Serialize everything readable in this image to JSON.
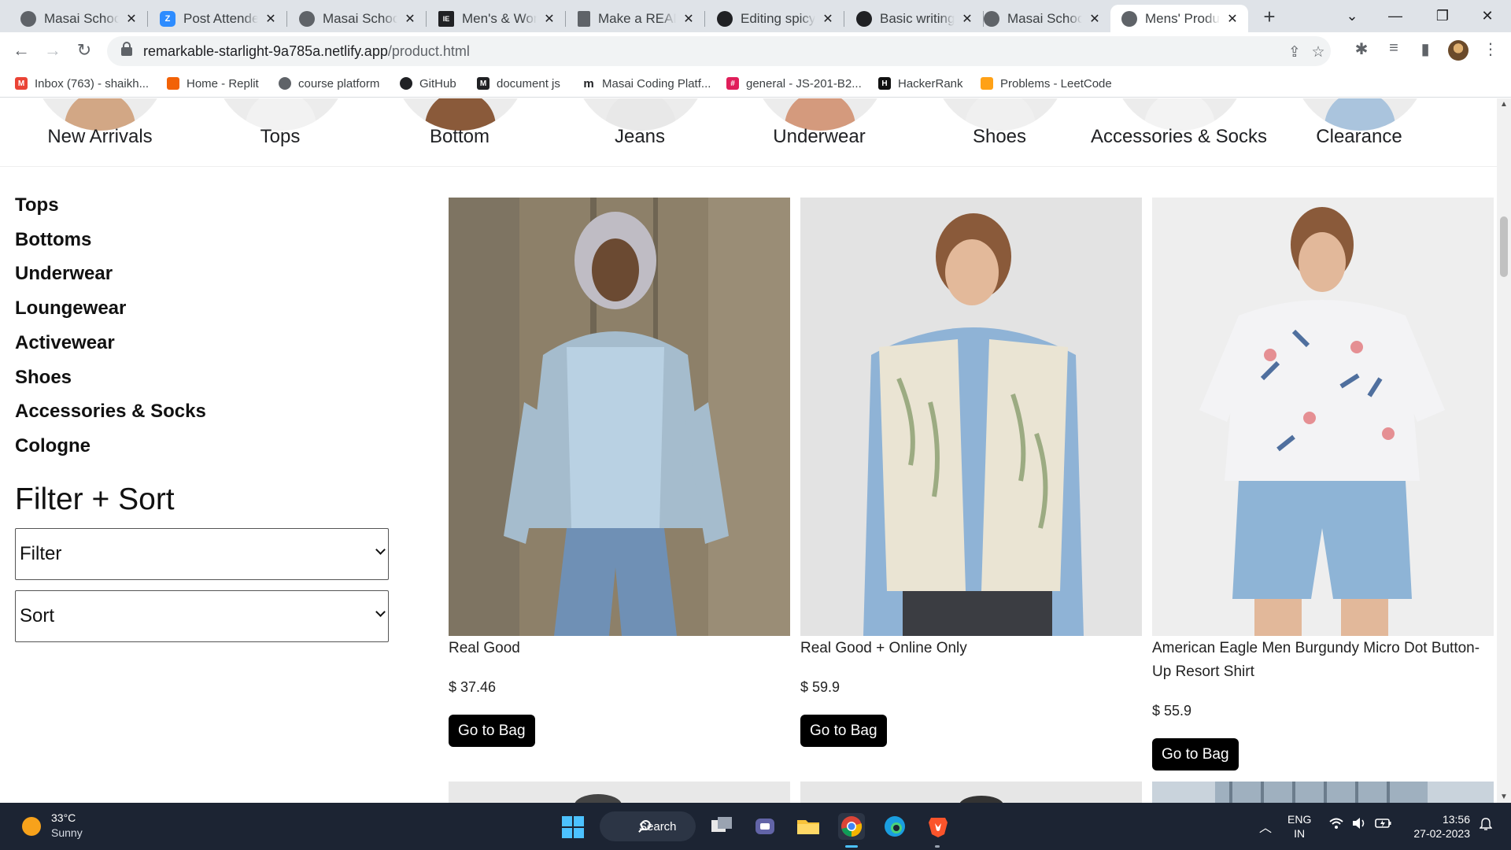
{
  "browser": {
    "tabs": [
      {
        "title": "Masai School |",
        "icon": "globe-icon"
      },
      {
        "title": "Post Attendee",
        "icon": "zoom-icon"
      },
      {
        "title": "Masai School |",
        "icon": "globe-icon"
      },
      {
        "title": "Men's & Wom",
        "icon": "ie-icon"
      },
      {
        "title": "Make a READ",
        "icon": "doc-icon"
      },
      {
        "title": "Editing spicy-",
        "icon": "github-icon"
      },
      {
        "title": "Basic writing a",
        "icon": "github-icon"
      },
      {
        "title": "Masai School",
        "icon": "globe-icon"
      },
      {
        "title": "Mens' Produc",
        "icon": "globe-icon",
        "active": true
      }
    ],
    "url": {
      "host": "remarkable-starlight-9a785a.netlify.app",
      "path": "/product.html"
    },
    "bookmarks": [
      {
        "label": "Inbox (763) - shaikh...",
        "icon": "gmail-icon",
        "color": "#ea4335"
      },
      {
        "label": "Home - Replit",
        "icon": "replit-icon",
        "color": "#f26207"
      },
      {
        "label": "course platform",
        "icon": "globe-icon",
        "color": "#5f6368"
      },
      {
        "label": "GitHub",
        "icon": "github-icon",
        "color": "#202124"
      },
      {
        "label": "document js",
        "icon": "masai-icon",
        "color": "#202124"
      },
      {
        "label": "Masai Coding Platf...",
        "icon": "masai-m-icon",
        "color": "#202124"
      },
      {
        "label": "general - JS-201-B2...",
        "icon": "slack-icon",
        "color": "#e01e5a"
      },
      {
        "label": "HackerRank",
        "icon": "hackerrank-icon",
        "color": "#111111"
      },
      {
        "label": "Problems - LeetCode",
        "icon": "leetcode-icon",
        "color": "#ffa116"
      }
    ]
  },
  "page": {
    "categories": [
      "New Arrivals",
      "Tops",
      "Bottom",
      "Jeans",
      "Underwear",
      "Shoes",
      "Accessories & Socks",
      "Clearance"
    ],
    "sidebar": [
      "Tops",
      "Bottoms",
      "Underwear",
      "Loungewear",
      "Activewear",
      "Shoes",
      "Accessories & Socks",
      "Cologne"
    ],
    "filter_sort": {
      "title": "Filter + Sort",
      "filter_label": "Filter",
      "sort_label": "Sort"
    },
    "products": [
      {
        "name": "Real Good",
        "price": "$ 37.46",
        "button": "Go to Bag"
      },
      {
        "name": "Real Good + Online Only",
        "price": "$ 59.9",
        "button": "Go to Bag"
      },
      {
        "name": "American Eagle Men Burgundy Micro Dot Button-Up Resort Shirt",
        "price": "$ 55.9",
        "button": "Go to Bag"
      }
    ]
  },
  "taskbar": {
    "weather": {
      "temp": "33°C",
      "desc": "Sunny"
    },
    "search": "Search",
    "lang": {
      "line1": "ENG",
      "line2": "IN"
    },
    "clock": {
      "time": "13:56",
      "date": "27-02-2023"
    }
  },
  "colors": {
    "accent_chrome_tab": "#dfe3e8",
    "button_bg": "#000000",
    "taskbar_bg": "#1c2433"
  }
}
